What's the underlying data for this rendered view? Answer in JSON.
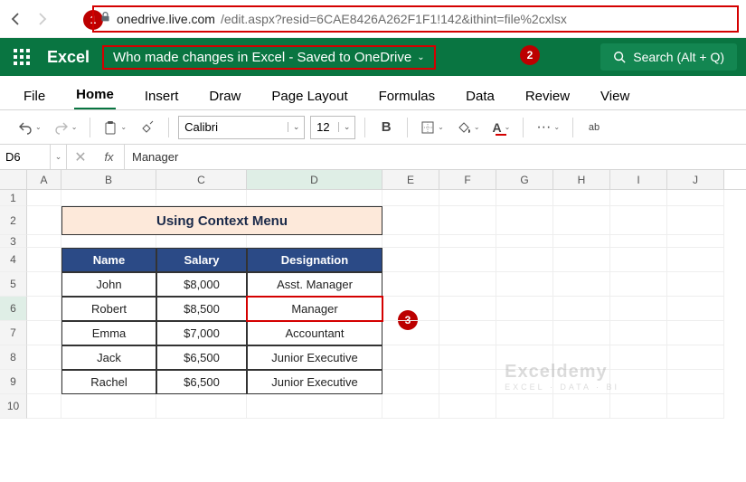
{
  "browser": {
    "url_host": "onedrive.live.com",
    "url_path": "/edit.aspx?resid=6CAE8426A262F1F1!142&ithint=file%2cxlsx"
  },
  "titlebar": {
    "app": "Excel",
    "doc_title": "Who made changes in Excel - Saved to OneDrive",
    "search": "Search (Alt + Q)"
  },
  "tabs": [
    "File",
    "Home",
    "Insert",
    "Draw",
    "Page Layout",
    "Formulas",
    "Data",
    "Review",
    "View"
  ],
  "toolbar": {
    "font_name": "Calibri",
    "font_size": "12",
    "bold": "B"
  },
  "fx": {
    "name_box": "D6",
    "fx_label": "fx",
    "value": "Manager"
  },
  "grid": {
    "cols": [
      "A",
      "B",
      "C",
      "D",
      "E",
      "F",
      "G",
      "H",
      "I",
      "J"
    ],
    "row_nums": [
      "1",
      "2",
      "3",
      "4",
      "5",
      "6",
      "7",
      "8",
      "9",
      "10"
    ],
    "title": "Using Context Menu",
    "headers": {
      "b": "Name",
      "c": "Salary",
      "d": "Designation"
    },
    "rows": [
      {
        "b": "John",
        "c": "$8,000",
        "d": "Asst. Manager"
      },
      {
        "b": "Robert",
        "c": "$8,500",
        "d": "Manager"
      },
      {
        "b": "Emma",
        "c": "$7,000",
        "d": "Accountant"
      },
      {
        "b": "Jack",
        "c": "$6,500",
        "d": "Junior Executive"
      },
      {
        "b": "Rachel",
        "c": "$6,500",
        "d": "Junior Executive"
      }
    ]
  },
  "badges": {
    "b1": "1",
    "b2": "2",
    "b3": "3"
  },
  "watermark": {
    "main": "Exceldemy",
    "sub": "EXCEL · DATA · BI"
  }
}
